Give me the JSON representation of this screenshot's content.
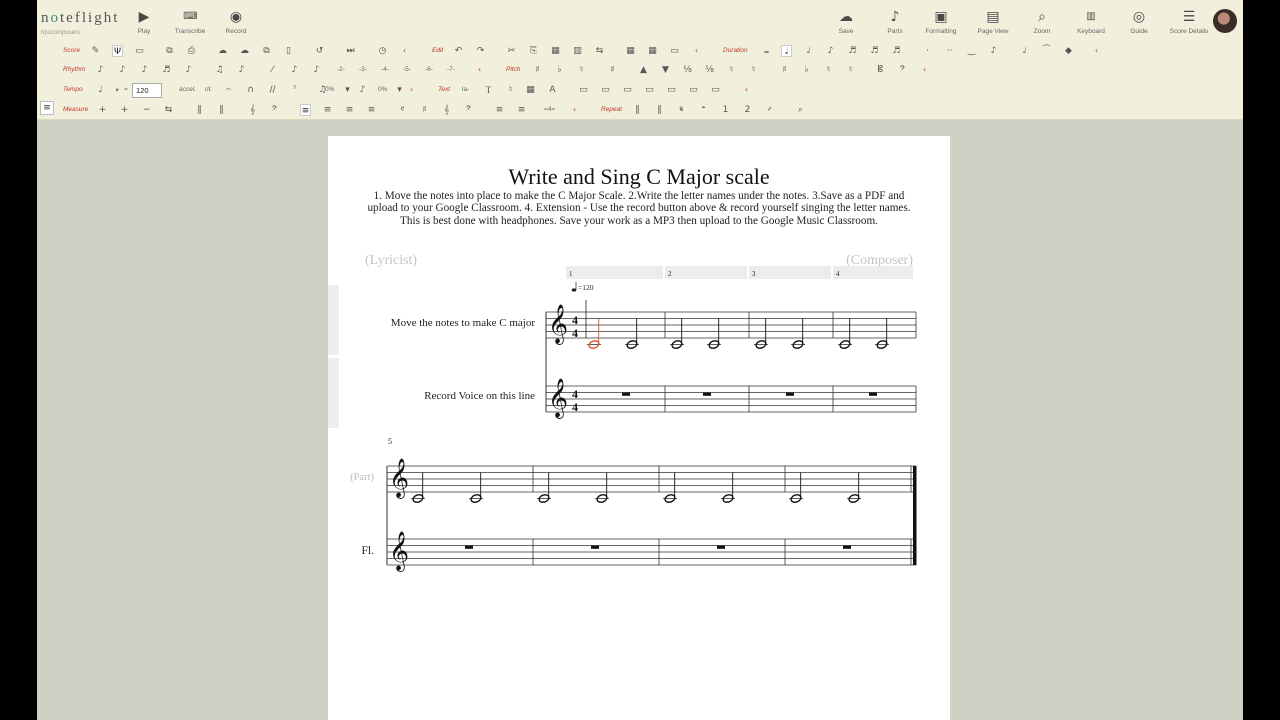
{
  "app": {
    "logo": "noteflight",
    "account": "hpscomposers"
  },
  "header_left": [
    {
      "id": "play",
      "label": "Play",
      "icon": "play-icon"
    },
    {
      "id": "transcribe",
      "label": "Transcribe",
      "icon": "transcribe-icon"
    },
    {
      "id": "record",
      "label": "Record",
      "icon": "record-icon"
    }
  ],
  "header_right": [
    {
      "id": "save",
      "label": "Save",
      "icon": "cloud-upload-icon"
    },
    {
      "id": "parts",
      "label": "Parts",
      "icon": "guitar-icon"
    },
    {
      "id": "formatting",
      "label": "Formatting",
      "icon": "formatting-icon"
    },
    {
      "id": "page-view",
      "label": "Page View",
      "icon": "page-icon"
    },
    {
      "id": "zoom",
      "label": "Zoom",
      "icon": "magnifier-icon"
    },
    {
      "id": "keyboard",
      "label": "Keyboard",
      "icon": "keyboard-icon"
    },
    {
      "id": "guide",
      "label": "Guide",
      "icon": "compass-icon"
    },
    {
      "id": "score-details",
      "label": "Score Details",
      "icon": "list-icon"
    }
  ],
  "palette": {
    "score": "Score",
    "edit": "Edit",
    "duration": "Duration",
    "rhythm": "Rhythm",
    "pitch": "Pitch",
    "tempo": "Tempo",
    "tempo_value": "120",
    "text": "Text",
    "measure": "Measure",
    "repeat": "Repeat",
    "accel": "accel.",
    "rit": "rit.",
    "percent_a": "0%",
    "percent_b": "0%",
    "equals": "=",
    "tuplets": [
      "-2-",
      "-3-",
      "-4-",
      "-5-",
      "-6-",
      "-7-"
    ],
    "text_la": "la-",
    "text_t": "T",
    "measure_count": "=4="
  },
  "score": {
    "title": "Write and Sing C Major scale",
    "instructions": "1. Move the notes into place to make the C Major Scale. 2.Write the letter names under the notes. 3.Save as a PDF and upload to your Google Classroom. 4. Extension - Use the record button above & record yourself singing the letter names. This is best done with headphones. Save your work as a MP3 then upload to the Google Music Classroom.",
    "lyricist": "(Lyricist)",
    "composer": "(Composer)",
    "tempo_mark": "=120",
    "time_signature": "4/4",
    "measure_numbers": [
      "1",
      "2",
      "3",
      "4"
    ],
    "system2_measure_number": "5",
    "staves": [
      {
        "name": "Move the notes to make C major"
      },
      {
        "name": "Record Voice on this line"
      }
    ],
    "system2_staves": [
      {
        "name": "(Part)"
      },
      {
        "name": "Fl."
      }
    ]
  },
  "colors": {
    "app_bg": "#cfd1c5",
    "toolbar_bg": "#f1f0dd",
    "palette_label": "#c2362a",
    "selected_note": "#e0522d"
  }
}
